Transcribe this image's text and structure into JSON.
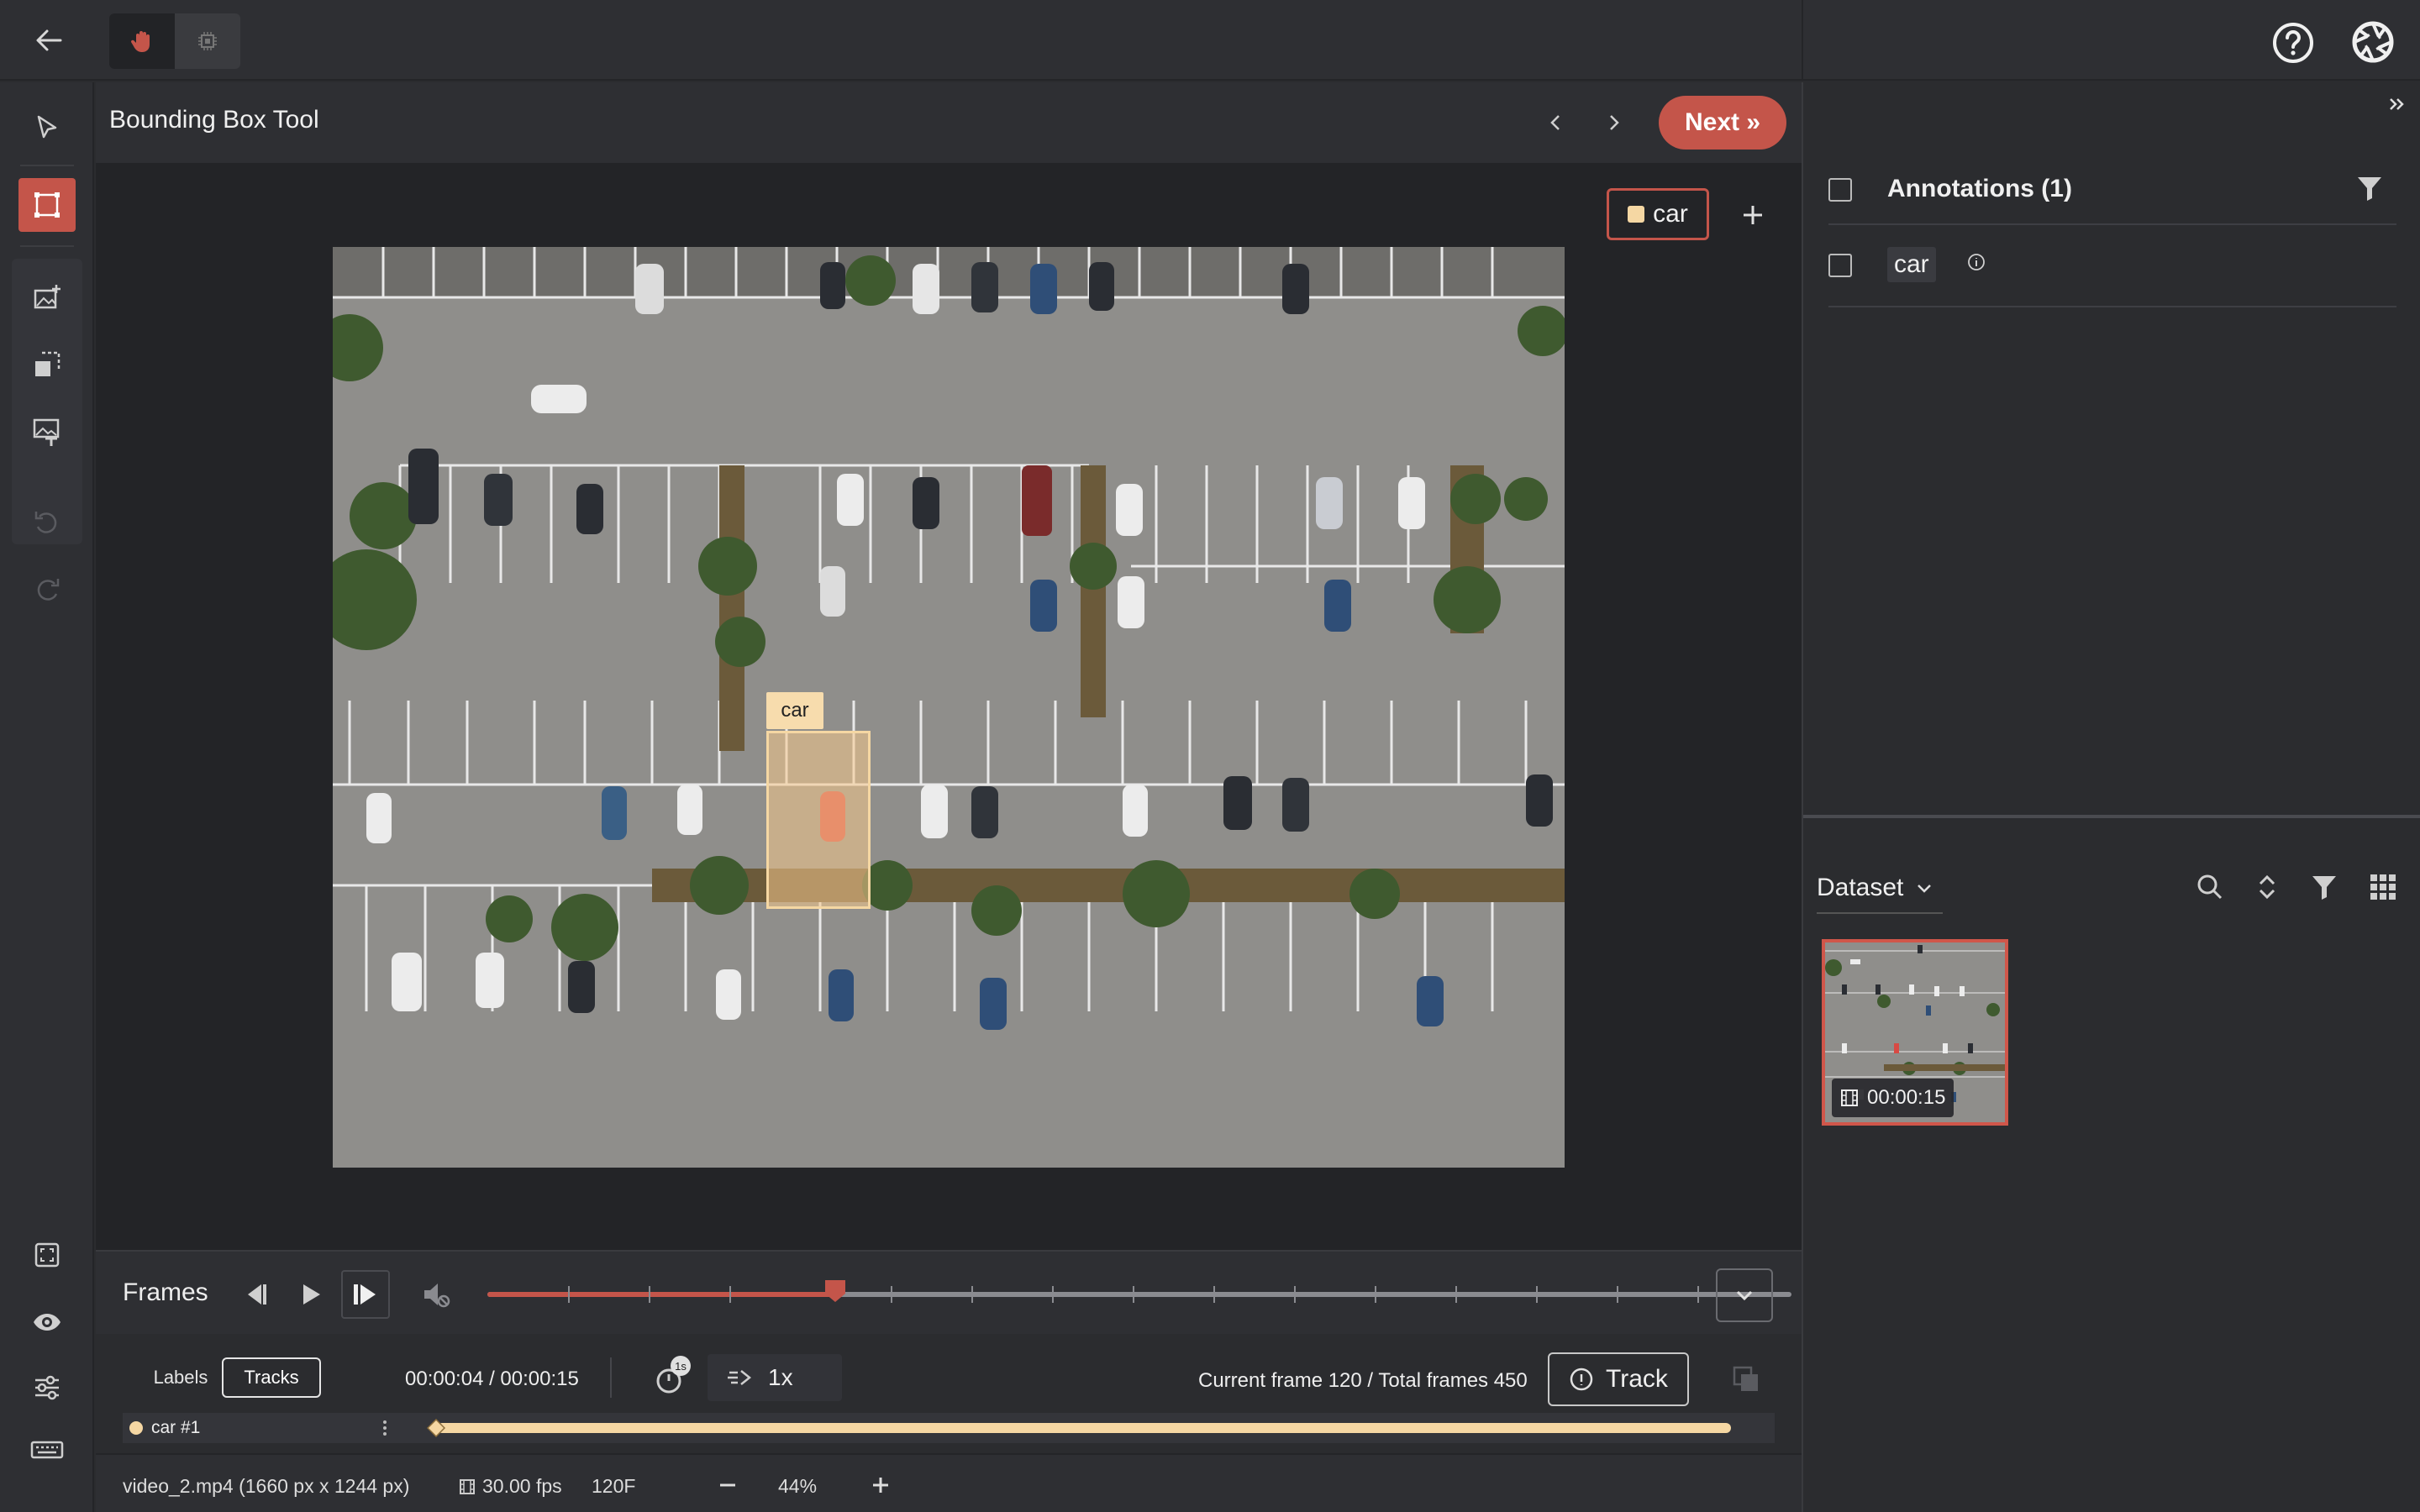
{
  "header": {
    "tool_title": "Bounding Box Tool",
    "next_label": "Next »"
  },
  "canvas": {
    "active_label": "car",
    "bbox_label": "car",
    "label_color": "#f5d7a3",
    "accent": "#c4554a"
  },
  "frames": {
    "title": "Frames",
    "progress_fraction": 0.267
  },
  "tracks": {
    "tab_labels": "Labels",
    "tab_tracks": "Tracks",
    "time": "00:00:04 / 00:00:15",
    "interval_badge": "1s",
    "speed": "1x",
    "frame_info": "Current frame 120 / Total frames 450",
    "track_button": "Track",
    "track_name": "car #1"
  },
  "status": {
    "file": "video_2.mp4 (1660 px x 1244 px)",
    "fps": "30.00 fps",
    "frame": "120F",
    "zoom": "44%"
  },
  "annotations": {
    "title": "Annotations (1)",
    "items": [
      {
        "label": "car"
      }
    ]
  },
  "dataset": {
    "dropdown": "Dataset",
    "thumb_duration": "00:00:15"
  },
  "icons": [
    "back-arrow-icon",
    "hand-icon",
    "chip-icon",
    "help-icon",
    "logo-icon",
    "select-arrow-icon",
    "bbox-icon",
    "image-add-icon",
    "crop-icon",
    "image-text-icon",
    "undo-icon",
    "redo-icon",
    "fit-icon",
    "eye-icon",
    "sliders-icon",
    "keyboard-icon",
    "chevron-left-icon",
    "chevron-right-icon",
    "plus-icon",
    "step-back-icon",
    "play-icon",
    "step-forward-icon",
    "mute-icon",
    "chevron-down-icon",
    "timer-icon",
    "speed-icon",
    "track-icon",
    "copy-icon",
    "film-icon",
    "minus-icon",
    "double-chevron-right-icon",
    "filter-icon",
    "info-icon",
    "search-icon",
    "sort-icon",
    "grid-icon"
  ]
}
